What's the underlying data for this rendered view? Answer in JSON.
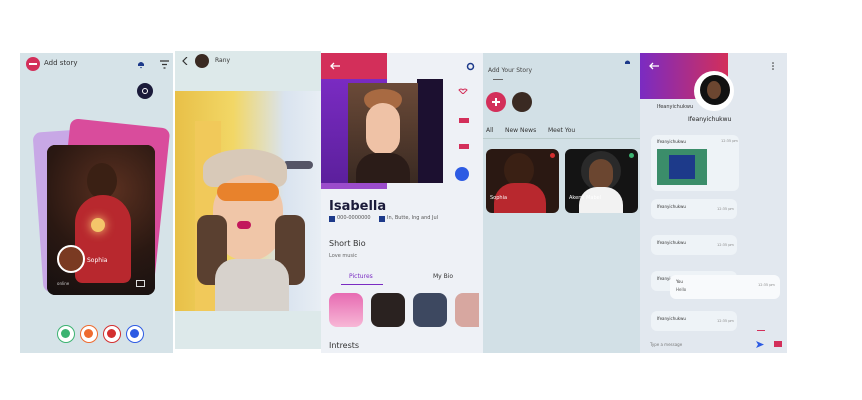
{
  "screen1": {
    "title": "Add story",
    "profile_name": "Sophia",
    "status": "online",
    "action_buttons": [
      "like",
      "favorite",
      "dislike",
      "info"
    ]
  },
  "screen2": {
    "user_name": "Rany"
  },
  "screen3": {
    "name": "Isabella",
    "phone": "000-0000000",
    "location": "In, Butte, Ing and Jul",
    "short_bio_heading": "Short Bio",
    "short_bio_text": "Love music",
    "tabs": [
      "Pictures",
      "My Bio"
    ],
    "interests_heading": "Intrests"
  },
  "screen4": {
    "add_story_label": "Add Your Story",
    "tabs": [
      "All",
      "New News",
      "Meet You"
    ],
    "cards": [
      {
        "name": "Sophia"
      },
      {
        "name": "Akemi Mabel"
      }
    ]
  },
  "screen5": {
    "header_name": "Ifeanyichukwu",
    "header_sub": "Ifeanyichukwu",
    "messages": [
      {
        "sender": "Ifeanyichukwu",
        "text": "",
        "time": "12:35 pm"
      },
      {
        "sender": "Ifeanyichukwu",
        "text": "",
        "time": "12:35 pm"
      },
      {
        "sender": "Ifeanyichukwu",
        "text": "",
        "time": "12:35 pm"
      },
      {
        "sender": "Ifeanyichukwu",
        "text": "",
        "time": "12:35 pm"
      },
      {
        "sender": "You",
        "text": "Hello",
        "time": "12:35 pm"
      },
      {
        "sender": "Ifeanyichukwu",
        "text": "",
        "time": "12:35 pm"
      }
    ],
    "input_placeholder": "Type a message"
  },
  "colors": {
    "brand_red": "#d32f5a",
    "purple": "#7a2bc2",
    "green": "#3cb371",
    "orange": "#ee6b2f",
    "blue": "#2d5be3"
  }
}
